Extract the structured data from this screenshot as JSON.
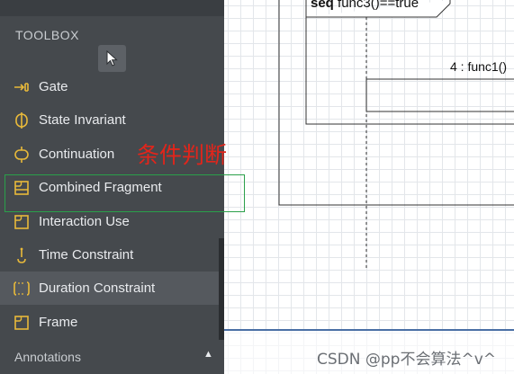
{
  "toolbox": {
    "title": "TOOLBOX",
    "items": [
      {
        "label": "Gate",
        "icon": "gate-icon"
      },
      {
        "label": "State Invariant",
        "icon": "state-invariant-icon"
      },
      {
        "label": "Continuation",
        "icon": "continuation-icon"
      },
      {
        "label": "Combined Fragment",
        "icon": "combined-fragment-icon"
      },
      {
        "label": "Interaction Use",
        "icon": "interaction-use-icon"
      },
      {
        "label": "Time Constraint",
        "icon": "time-constraint-icon"
      },
      {
        "label": "Duration Constraint",
        "icon": "duration-constraint-icon"
      },
      {
        "label": "Frame",
        "icon": "frame-icon"
      }
    ],
    "annotations_label": "Annotations"
  },
  "diagram": {
    "fragment_keyword": "seq",
    "fragment_guard": "func3()==true",
    "message_label": "4 : func1()"
  },
  "overlay": {
    "annotation": "条件判断",
    "watermark": "CSDN @pp不会算法^v^"
  },
  "colors": {
    "toolbox_bg": "#45494d",
    "icon_yellow": "#e8b93a",
    "annotation_red": "#e1251b",
    "highlight_green": "#2aa04a"
  }
}
